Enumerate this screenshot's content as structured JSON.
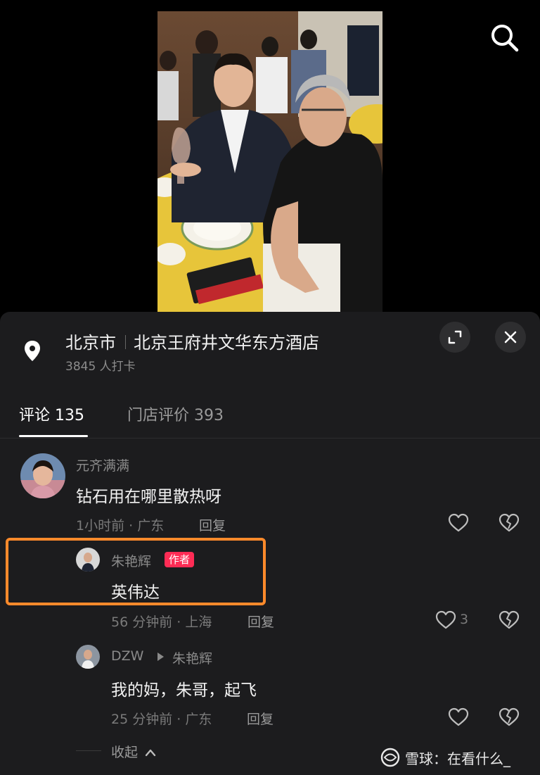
{
  "video": {
    "alt": "photo"
  },
  "location": {
    "city": "北京市",
    "hotel": "北京王府井文华东方酒店",
    "checkins": "3845 人打卡"
  },
  "tabs": {
    "comments": "评论 135",
    "reviews": "门店评价 393"
  },
  "comments": [
    {
      "user": "元齐满满",
      "text": "钻石用在哪里散热呀",
      "time": "1小时前 · 广东",
      "reply": "回复",
      "likes": ""
    },
    {
      "user": "朱艳辉",
      "badge": "作者",
      "text": "英伟达",
      "time": "56 分钟前 · 上海",
      "reply": "回复",
      "likes": "3"
    },
    {
      "user": "DZW",
      "reply_to": "朱艳辉",
      "text": "我的妈，朱哥，起飞",
      "time": "25 分钟前 · 广东",
      "reply": "回复",
      "likes": ""
    }
  ],
  "collapse": "收起",
  "watermark": "雪球：在看什么_",
  "colors": {
    "badge": "#fe2c55",
    "highlight": "#ff8a2b",
    "sheet": "#1c1c1e"
  },
  "icons": [
    "search-icon",
    "location-pin-icon",
    "expand-icon",
    "close-icon",
    "heart-icon",
    "broken-heart-icon",
    "chevron-up-icon",
    "snowball-logo-icon"
  ]
}
